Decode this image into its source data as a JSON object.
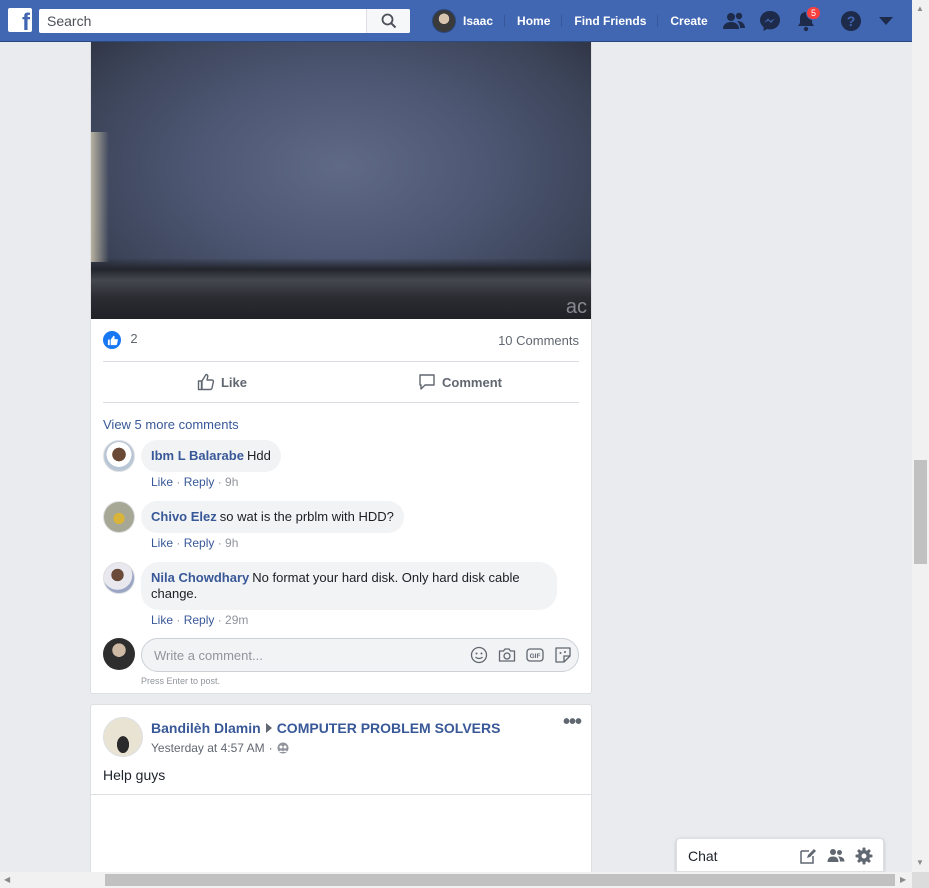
{
  "topbar": {
    "search_placeholder": "Search",
    "profile_name": "Isaac",
    "nav": [
      "Home",
      "Find Friends",
      "Create"
    ],
    "notification_count": "5"
  },
  "post1": {
    "photo_brand": "ac",
    "like_count": "2",
    "comments_count": "10 Comments",
    "like_label": "Like",
    "comment_label": "Comment",
    "view_more": "View 5 more comments",
    "comments": [
      {
        "name": "Ibm L Balarabe",
        "text": "Hdd",
        "like": "Like",
        "reply": "Reply",
        "time": "9h"
      },
      {
        "name": "Chivo Elez",
        "text": "so wat is the prblm with HDD?",
        "like": "Like",
        "reply": "Reply",
        "time": "9h"
      },
      {
        "name": "Nila Chowdhary",
        "text": "No format your hard disk. Only hard disk cable change.",
        "like": "Like",
        "reply": "Reply",
        "time": "29m"
      }
    ],
    "composer_placeholder": "Write a comment...",
    "press_enter": "Press Enter to post."
  },
  "post2": {
    "author": "Bandilèh Dlamin",
    "group": "COMPUTER PROBLEM SOLVERS",
    "time": "Yesterday at 4:57 AM",
    "text": "Help guys"
  },
  "chat": {
    "label": "Chat"
  },
  "colors": {
    "brand": "#4267b2",
    "link": "#385898",
    "like_blue": "#1877f2"
  }
}
